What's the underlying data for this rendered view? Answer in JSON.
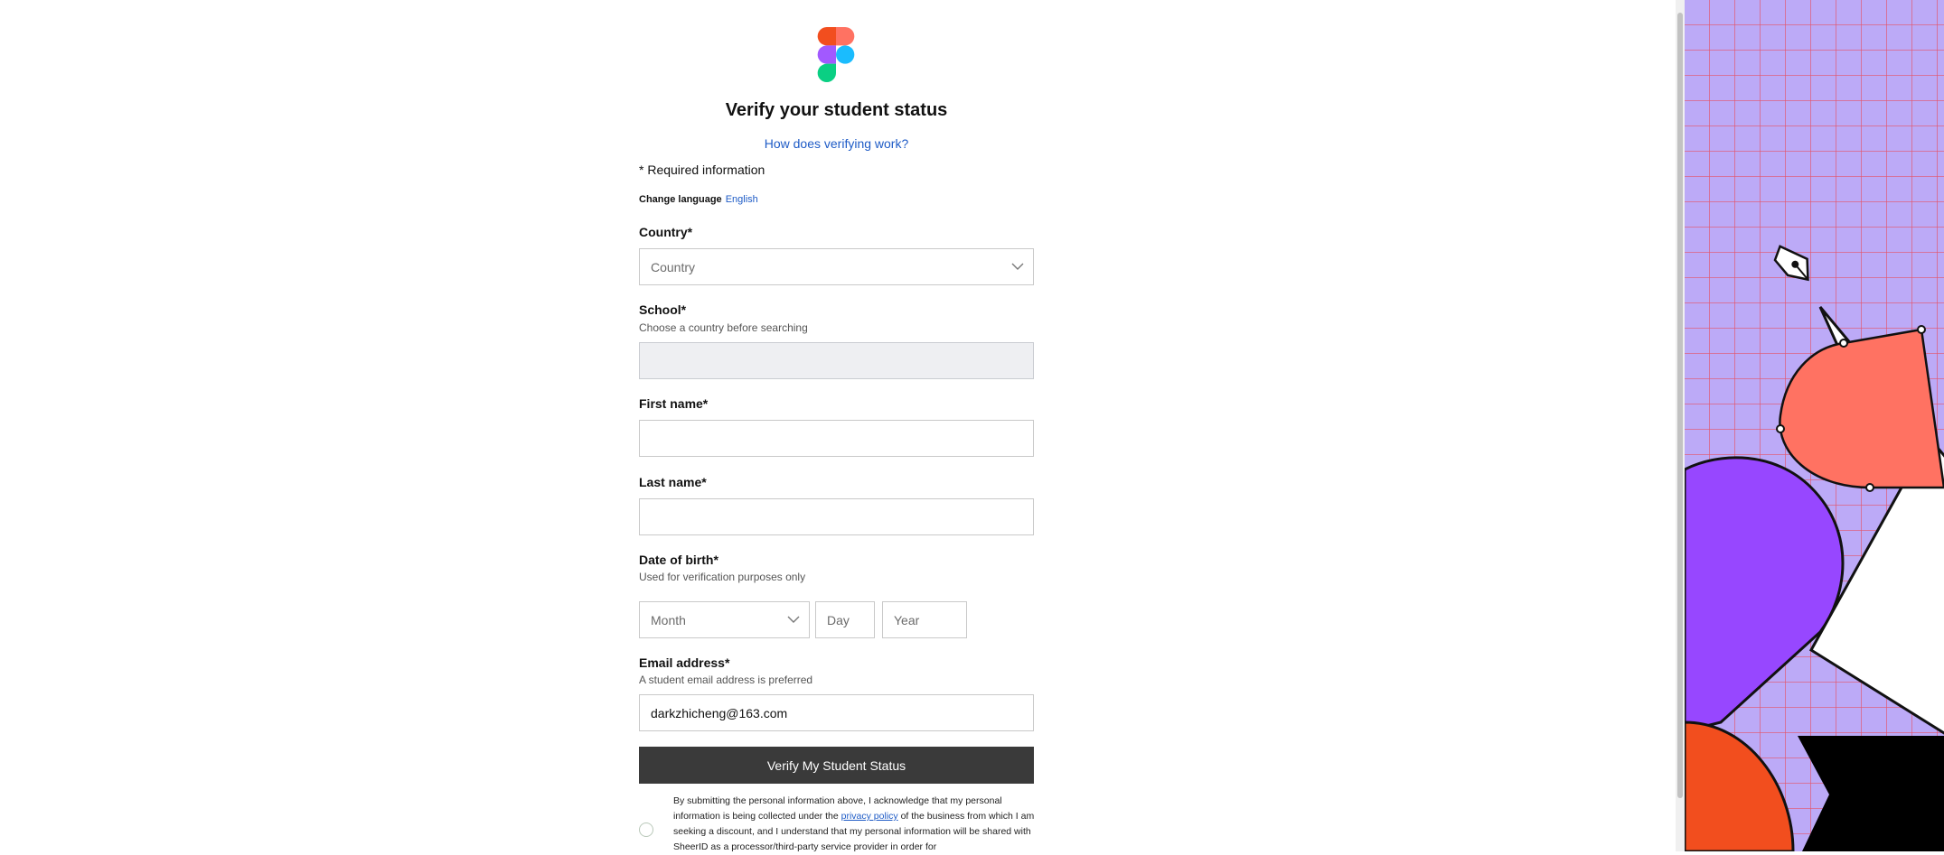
{
  "header": {
    "logo_icon": "figma-logo",
    "title": "Verify your student status",
    "how_link": "How does verifying work?"
  },
  "form": {
    "required_note": "* Required information",
    "language": {
      "label": "Change language",
      "value": "English"
    },
    "country": {
      "label": "Country*",
      "placeholder": "Country"
    },
    "school": {
      "label": "School*",
      "hint": "Choose a country before searching",
      "value": ""
    },
    "first_name": {
      "label": "First name*",
      "value": ""
    },
    "last_name": {
      "label": "Last name*",
      "value": ""
    },
    "dob": {
      "label": "Date of birth*",
      "hint": "Used for verification purposes only",
      "month_placeholder": "Month",
      "day_placeholder": "Day",
      "year_placeholder": "Year"
    },
    "email": {
      "label": "Email address*",
      "hint": "A student email address is preferred",
      "value": "darkzhicheng@163.com"
    },
    "submit_label": "Verify My Student Status",
    "consent": {
      "part1": "By submitting the personal information above, I acknowledge that my personal information is being collected under the",
      "link": "privacy policy",
      "part2": "of the business from which I am seeking a discount, and I understand that my personal information will be shared with SheerID as a processor/third-party service provider in order for"
    }
  },
  "colors": {
    "link": "#1e5bc6",
    "button": "#3a3a3a",
    "art_background": "#bcaaf7",
    "art_grid": "#e4536a",
    "art_coral": "#ff7262",
    "art_purple": "#9747ff",
    "art_red": "#f24e1e"
  }
}
